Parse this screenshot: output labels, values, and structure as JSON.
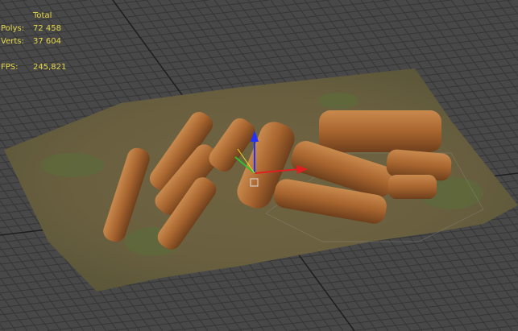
{
  "stats": {
    "header": "Total",
    "polys_label": "Polys:",
    "polys_value": "72 458",
    "verts_label": "Verts:",
    "verts_value": "37 604",
    "fps_label": "FPS:",
    "fps_value": "245,821"
  },
  "colors": {
    "background": "#484848",
    "grid_line": "#333333",
    "stats_text": "#e6d84a"
  }
}
